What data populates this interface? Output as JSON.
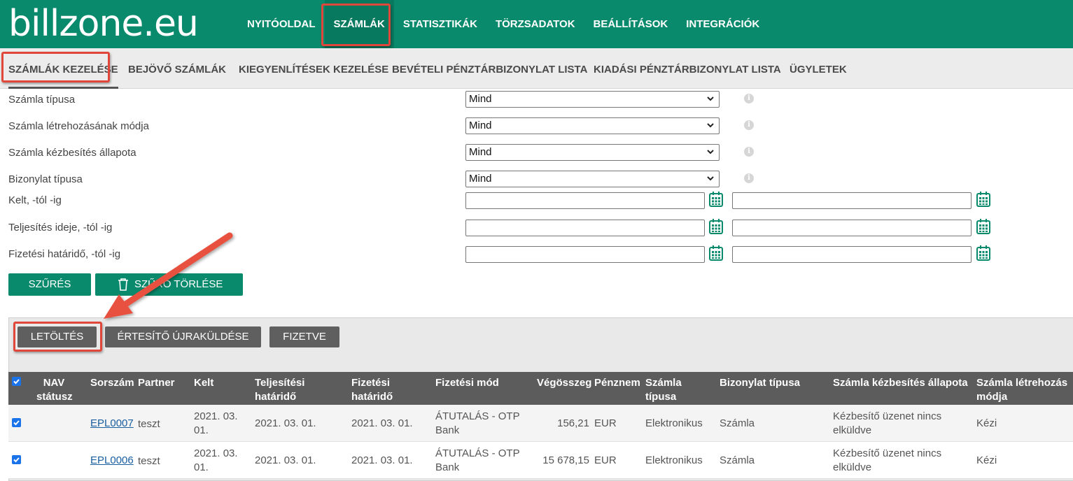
{
  "logo": "billzone.eu",
  "topnav": [
    "NYITÓOLDAL",
    "SZÁMLÁK",
    "STATISZTIKÁK",
    "TÖRZSADATOK",
    "BEÁLLÍTÁSOK",
    "INTEGRÁCIÓK"
  ],
  "subnav": [
    "SZÁMLÁK KEZELÉSE",
    "BEJÖVŐ SZÁMLÁK",
    "KIEGYENLÍTÉSEK KEZELÉSE",
    "BEVÉTELI PÉNZTÁRBIZONYLAT LISTA",
    "KIADÁSI PÉNZTÁRBIZONYLAT LISTA",
    "ÜGYLETEK"
  ],
  "filters": {
    "invoice_type": {
      "label": "Számla típusa",
      "value": "Mind"
    },
    "creation_mode": {
      "label": "Számla létrehozásának módja",
      "value": "Mind"
    },
    "delivery_state": {
      "label": "Számla kézbesítés állapota",
      "value": "Mind"
    },
    "document_type": {
      "label": "Bizonylat típusa",
      "value": "Mind"
    },
    "issue_date": {
      "label": "Kelt, -tól -ig"
    },
    "fulfillment_date": {
      "label": "Teljesítés ideje, -tól -ig"
    },
    "due_date": {
      "label": "Fizetési határidő, -tól -ig"
    },
    "info_glyph": "i",
    "filter_button": "SZŰRÉS",
    "clear_button": "SZŰRŐ TÖRLÉSE"
  },
  "actions": {
    "download": "LETÖLTÉS",
    "resend": "ÉRTESÍTŐ ÚJRAKÜLDÉSE",
    "paid": "FIZETVE"
  },
  "table": {
    "headers": {
      "nav": [
        "NAV",
        "státusz"
      ],
      "serial": "Sorszám",
      "partner": "Partner",
      "issued": "Kelt",
      "fulfillment": [
        "Teljesítési",
        "határidő"
      ],
      "payment_due": [
        "Fizetési",
        "határidő"
      ],
      "payment_method": "Fizetési mód",
      "total": "Végösszeg",
      "currency": "Pénznem",
      "invoice_type": [
        "Számla",
        "típusa"
      ],
      "doc_type": "Bizonylat típusa",
      "delivery": "Számla kézbesítés állapota",
      "creation": [
        "Számla létrehozás",
        "módja"
      ]
    },
    "rows": [
      {
        "serial": "EPL0007",
        "partner": "teszt",
        "issued": [
          "2021. 03.",
          "01."
        ],
        "fulfillment": "2021. 03. 01.",
        "payment_due": "2021. 03. 01.",
        "payment_method": [
          "ÁTUTALÁS - OTP",
          "Bank"
        ],
        "total": "156,21",
        "currency": "EUR",
        "invoice_type": "Elektronikus",
        "doc_type": "Számla",
        "delivery": [
          "Kézbesítő üzenet nincs",
          "elküldve"
        ],
        "creation": "Kézi"
      },
      {
        "serial": "EPL0006",
        "partner": "teszt",
        "issued": [
          "2021. 03.",
          "01."
        ],
        "fulfillment": "2021. 03. 01.",
        "payment_due": "2021. 03. 01.",
        "payment_method": [
          "ÁTUTALÁS - OTP",
          "Bank"
        ],
        "total": "15 678,15",
        "currency": "EUR",
        "invoice_type": "Elektronikus",
        "doc_type": "Számla",
        "delivery": [
          "Kézbesítő üzenet nincs",
          "elküldve"
        ],
        "creation": "Kézi"
      }
    ]
  },
  "colors": {
    "brand": "#0a8a6c",
    "highlight": "#e0473a",
    "arrow": "#e8513f",
    "header_bg": "#5c5c5c"
  }
}
